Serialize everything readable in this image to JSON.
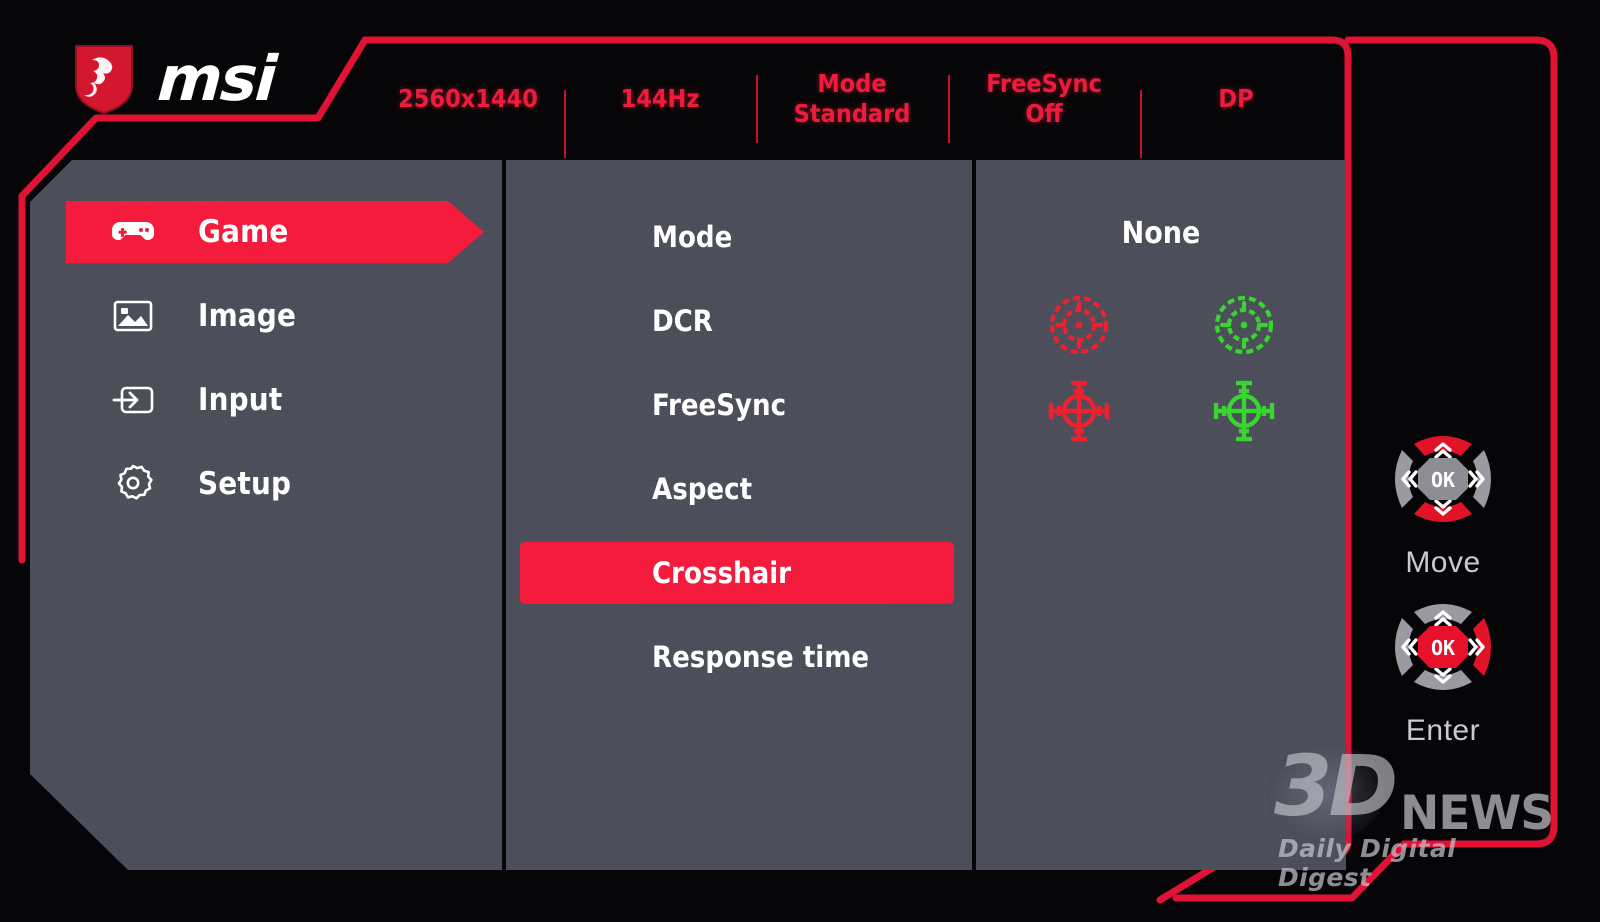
{
  "brand": {
    "logo_icon": "msi-dragon-shield-icon",
    "wordmark": "msi"
  },
  "status_bar": {
    "items": [
      {
        "line1": "2560x1440",
        "line2": ""
      },
      {
        "line1": "144Hz",
        "line2": ""
      },
      {
        "line1": "Mode",
        "line2": "Standard"
      },
      {
        "line1": "FreeSync",
        "line2": "Off"
      },
      {
        "line1": "DP",
        "line2": ""
      }
    ]
  },
  "sidebar": {
    "items": [
      {
        "label": "Game",
        "icon": "gamepad-icon",
        "active": true
      },
      {
        "label": "Image",
        "icon": "picture-icon",
        "active": false
      },
      {
        "label": "Input",
        "icon": "input-arrow-icon",
        "active": false
      },
      {
        "label": "Setup",
        "icon": "gear-icon",
        "active": false
      }
    ]
  },
  "submenu": {
    "items": [
      {
        "label": "Mode",
        "active": false
      },
      {
        "label": "DCR",
        "active": false
      },
      {
        "label": "FreeSync",
        "active": false
      },
      {
        "label": "Aspect",
        "active": false
      },
      {
        "label": "Crosshair",
        "active": true
      },
      {
        "label": "Response time",
        "active": false
      }
    ]
  },
  "options": {
    "title": "None",
    "items": [
      {
        "name": "crosshair-circle-red",
        "style": "circle",
        "color": "#ef2030"
      },
      {
        "name": "crosshair-circle-green",
        "style": "circle",
        "color": "#38d430"
      },
      {
        "name": "crosshair-cross-red",
        "style": "cross",
        "color": "#ef2030"
      },
      {
        "name": "crosshair-cross-green",
        "style": "cross",
        "color": "#38d430"
      }
    ]
  },
  "nav_hints": [
    {
      "label": "Move",
      "ok_text": "OK",
      "active": [
        "up",
        "down"
      ]
    },
    {
      "label": "Enter",
      "ok_text": "OK",
      "active": [
        "ok",
        "right"
      ]
    }
  ],
  "watermark": {
    "mark": "3D",
    "name": "NEWS",
    "tagline": "Daily Digital Digest"
  },
  "colors": {
    "accent_red": "#f41b3c",
    "panel_gray": "#4a4d59",
    "status_red": "#ef1b3c",
    "crosshair_green": "#38d430",
    "background": "#060608"
  }
}
